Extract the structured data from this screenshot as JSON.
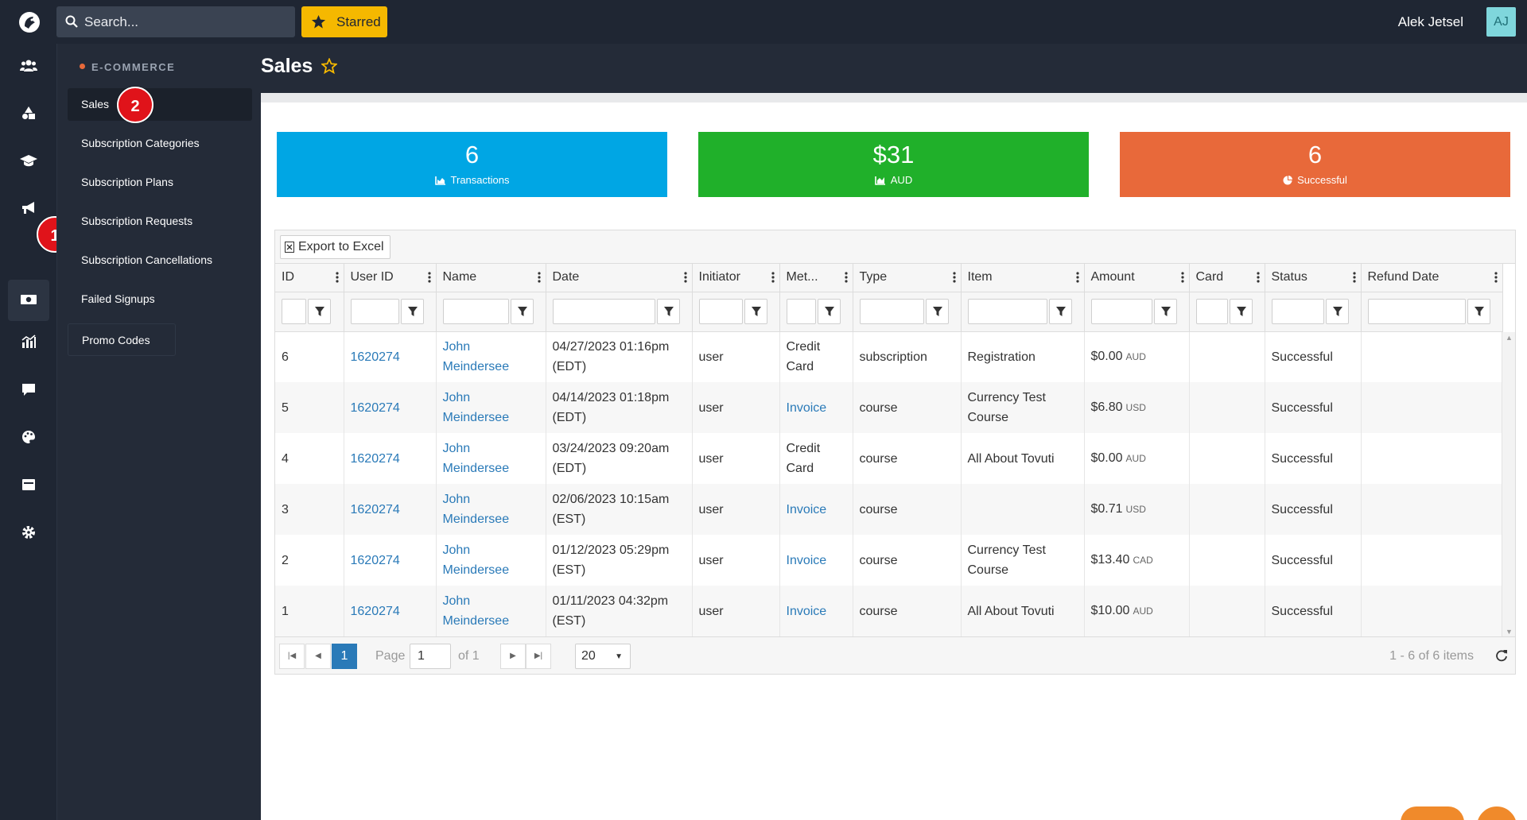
{
  "topbar": {
    "search_placeholder": "Search...",
    "starred_label": "Starred",
    "user_name": "Alek Jetsel",
    "avatar_initials": "AJ"
  },
  "rail": {
    "icons": [
      "users-icon",
      "shapes-icon",
      "graduation-cap-icon",
      "megaphone-icon",
      "money-icon",
      "chart-icon",
      "chat-icon",
      "palette-icon",
      "window-icon",
      "gear-icon"
    ],
    "badge": "1"
  },
  "section_nav": {
    "title": "E-COMMERCE",
    "items": [
      {
        "label": "Sales"
      },
      {
        "label": "Subscription Categories"
      },
      {
        "label": "Subscription Plans"
      },
      {
        "label": "Subscription Requests"
      },
      {
        "label": "Subscription Cancellations"
      },
      {
        "label": "Failed Signups"
      },
      {
        "label": "Promo Codes"
      }
    ],
    "badge": "2"
  },
  "page": {
    "title": "Sales"
  },
  "stats": [
    {
      "value": "6",
      "label": "Transactions",
      "color": "#00a6e4"
    },
    {
      "value": "$31",
      "label": "AUD",
      "color": "#20b02a"
    },
    {
      "value": "6",
      "label": "Successful",
      "color": "#e8693a"
    }
  ],
  "grid": {
    "export_label": "Export to Excel",
    "columns": [
      "ID",
      "User ID",
      "Name",
      "Date",
      "Initiator",
      "Met...",
      "Type",
      "Item",
      "Amount",
      "Card",
      "Status",
      "Refund Date"
    ],
    "rows": [
      {
        "id": "6",
        "user_id": "1620274",
        "name": "John Meindersee",
        "date": "04/27/2023 01:16pm (EDT)",
        "initiator": "user",
        "method": "Credit Card",
        "method_link": false,
        "type": "subscription",
        "item": "Registration",
        "amount": "$0.00",
        "currency": "AUD",
        "card": "",
        "status": "Successful",
        "refund_date": ""
      },
      {
        "id": "5",
        "user_id": "1620274",
        "name": "John Meindersee",
        "date": "04/14/2023 01:18pm (EDT)",
        "initiator": "user",
        "method": "Invoice",
        "method_link": true,
        "type": "course",
        "item": "Currency Test Course",
        "amount": "$6.80",
        "currency": "USD",
        "card": "",
        "status": "Successful",
        "refund_date": ""
      },
      {
        "id": "4",
        "user_id": "1620274",
        "name": "John Meindersee",
        "date": "03/24/2023 09:20am (EDT)",
        "initiator": "user",
        "method": "Credit Card",
        "method_link": false,
        "type": "course",
        "item": "All About Tovuti",
        "amount": "$0.00",
        "currency": "AUD",
        "card": "",
        "status": "Successful",
        "refund_date": ""
      },
      {
        "id": "3",
        "user_id": "1620274",
        "name": "John Meindersee",
        "date": "02/06/2023 10:15am (EST)",
        "initiator": "user",
        "method": "Invoice",
        "method_link": true,
        "type": "course",
        "item": "",
        "amount": "$0.71",
        "currency": "USD",
        "card": "",
        "status": "Successful",
        "refund_date": ""
      },
      {
        "id": "2",
        "user_id": "1620274",
        "name": "John Meindersee",
        "date": "01/12/2023 05:29pm (EST)",
        "initiator": "user",
        "method": "Invoice",
        "method_link": true,
        "type": "course",
        "item": "Currency Test Course",
        "amount": "$13.40",
        "currency": "CAD",
        "card": "",
        "status": "Successful",
        "refund_date": ""
      },
      {
        "id": "1",
        "user_id": "1620274",
        "name": "John Meindersee",
        "date": "01/11/2023 04:32pm (EST)",
        "initiator": "user",
        "method": "Invoice",
        "method_link": true,
        "type": "course",
        "item": "All About Tovuti",
        "amount": "$10.00",
        "currency": "AUD",
        "card": "",
        "status": "Successful",
        "refund_date": ""
      }
    ]
  },
  "pager": {
    "current_page": "1",
    "page_label": "Page",
    "page_input": "1",
    "of_label": "of 1",
    "page_size": "20",
    "info": "1 - 6 of 6 items"
  }
}
